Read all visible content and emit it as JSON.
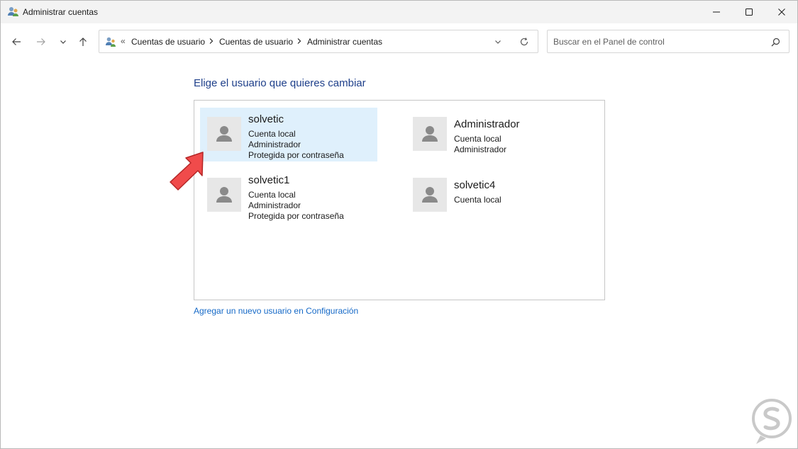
{
  "window": {
    "title": "Administrar cuentas"
  },
  "address": {
    "chevron": "«",
    "breadcrumbs": [
      "Cuentas de usuario",
      "Cuentas de usuario",
      "Administrar cuentas"
    ]
  },
  "search": {
    "placeholder": "Buscar en el Panel de control"
  },
  "main": {
    "heading": "Elige el usuario que quieres cambiar",
    "accounts": [
      {
        "name": "solvetic",
        "details": [
          "Cuenta local",
          "Administrador",
          "Protegida por contraseña"
        ],
        "selected": true
      },
      {
        "name": "Administrador",
        "details": [
          "Cuenta local",
          "Administrador"
        ],
        "selected": false
      },
      {
        "name": "solvetic1",
        "details": [
          "Cuenta local",
          "Administrador",
          "Protegida por contraseña"
        ],
        "selected": false
      },
      {
        "name": "solvetic4",
        "details": [
          "Cuenta local"
        ],
        "selected": false
      }
    ],
    "add_user_link": "Agregar un nuevo usuario en Configuración"
  },
  "colors": {
    "heading": "#1e3f8a",
    "link": "#1569c7",
    "selected_bg": "#dff0fc",
    "pointer_arrow": "#f04b4b",
    "avatar_glyph": "#8a8a8a"
  },
  "icons": {
    "app": "user-accounts-icon",
    "back": "arrow-left-icon",
    "forward": "arrow-right-icon",
    "recent": "chevron-down-icon",
    "up": "arrow-up-icon",
    "refresh": "refresh-icon",
    "search": "search-icon",
    "avatar": "user-avatar-icon",
    "pointer": "red-arrow-pointer-icon"
  }
}
